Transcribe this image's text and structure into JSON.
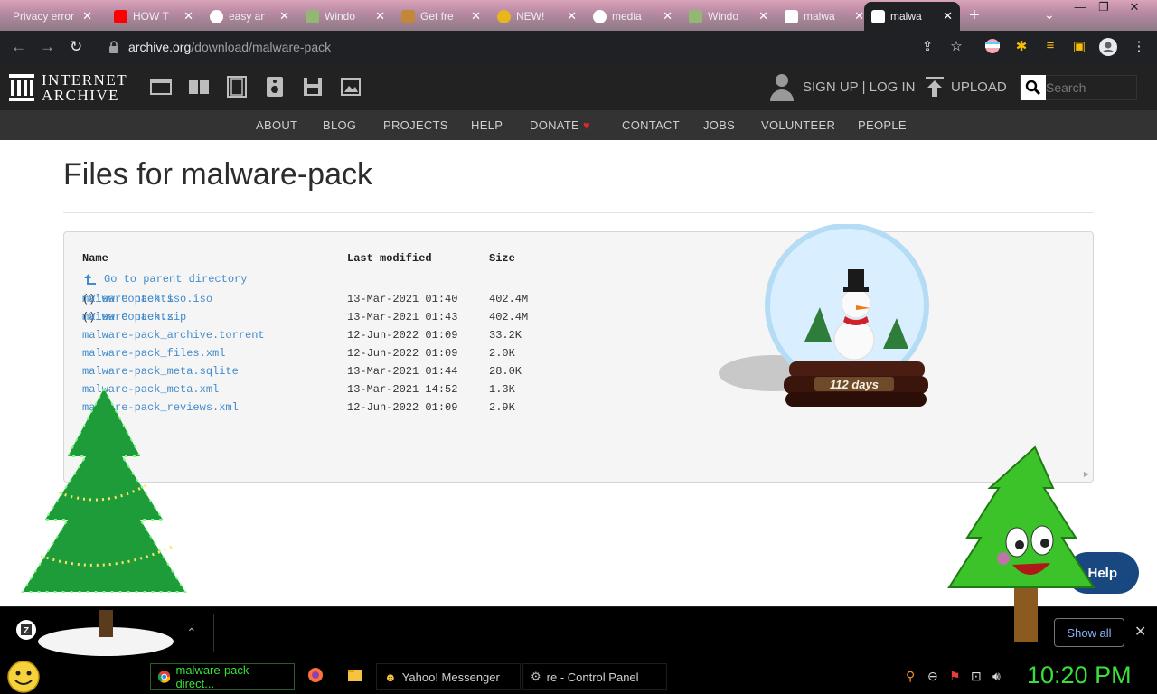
{
  "browser": {
    "tabs": [
      {
        "title": "Privacy error",
        "icon": "warning-icon",
        "color": "#d93025"
      },
      {
        "title": "HOW T",
        "icon": "youtube-icon",
        "color": "#ff0000"
      },
      {
        "title": "easy an",
        "icon": "google-icon",
        "color": "#4285f4"
      },
      {
        "title": "Windo",
        "icon": "wikihow-icon",
        "color": "#93b874"
      },
      {
        "title": "Get fre",
        "icon": "shield-icon",
        "color": "#c2883a"
      },
      {
        "title": "NEW!",
        "icon": "emoji-icon",
        "color": "#e8b61a"
      },
      {
        "title": "media",
        "icon": "google-icon",
        "color": "#4285f4"
      },
      {
        "title": "Windo",
        "icon": "wikihow-icon",
        "color": "#93b874"
      },
      {
        "title": "malwa",
        "icon": "archive-icon",
        "color": "#ffffff"
      },
      {
        "title": "malwa",
        "icon": "archive-icon",
        "color": "#ffffff",
        "active": true
      }
    ],
    "url_domain": "archive.org",
    "url_path": "/download/malware-pack"
  },
  "ia": {
    "logo_line1": "INTERNET",
    "logo_line2": "ARCHIVE",
    "signup": "SIGN UP | LOG IN",
    "upload": "UPLOAD",
    "search_placeholder": "Search",
    "nav": [
      "ABOUT",
      "BLOG",
      "PROJECTS",
      "HELP",
      "DONATE",
      "CONTACT",
      "JOBS",
      "VOLUNTEER",
      "PEOPLE"
    ]
  },
  "main": {
    "title": "Files for malware-pack",
    "columns": {
      "name": "Name",
      "modified": "Last modified",
      "size": "Size"
    },
    "parent_link": "Go to parent directory",
    "view_contents": "View Contents",
    "files": [
      {
        "name": "malware pack iso.iso",
        "view": true,
        "modified": "13-Mar-2021 01:40",
        "size": "402.4M"
      },
      {
        "name": "malware pack.zip",
        "view": true,
        "modified": "13-Mar-2021 01:43",
        "size": "402.4M"
      },
      {
        "name": "malware-pack_archive.torrent",
        "view": false,
        "modified": "12-Jun-2022 01:09",
        "size": "33.2K"
      },
      {
        "name": "malware-pack_files.xml",
        "view": false,
        "modified": "12-Jun-2022 01:09",
        "size": "2.0K"
      },
      {
        "name": "malware-pack_meta.sqlite",
        "view": false,
        "modified": "13-Mar-2021 01:44",
        "size": "28.0K"
      },
      {
        "name": "malware-pack_meta.xml",
        "view": false,
        "modified": "13-Mar-2021 14:52",
        "size": "1.3K"
      },
      {
        "name": "malware-pack_reviews.xml",
        "view": false,
        "modified": "12-Jun-2022 01:09",
        "size": "2.9K"
      }
    ],
    "countdown": "112 days",
    "help_label": "Help"
  },
  "shelf": {
    "show_all": "Show all"
  },
  "taskbar": {
    "items": [
      "malware-pack direct...",
      "Yahoo! Messenger",
      "re - Control Panel"
    ],
    "clock": "10:20 PM"
  },
  "colors": {
    "link": "#428bca",
    "clock": "#39e039",
    "donate_heart": "#e0262b"
  }
}
